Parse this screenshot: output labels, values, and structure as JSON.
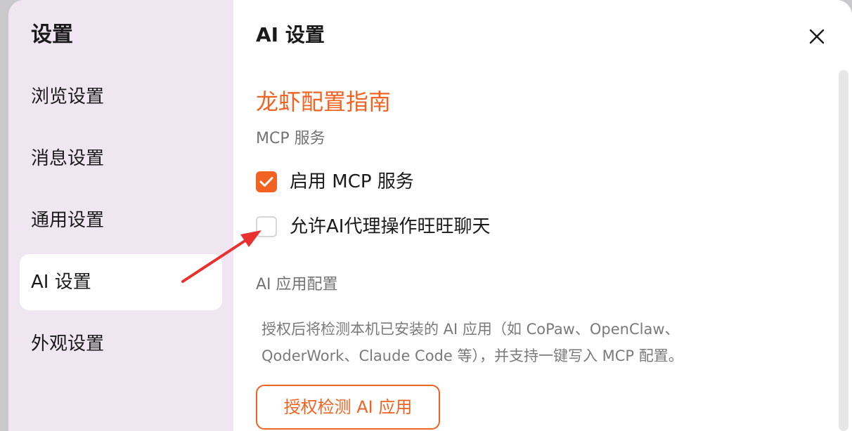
{
  "sidebar": {
    "title": "设置",
    "items": [
      {
        "label": "浏览设置"
      },
      {
        "label": "消息设置"
      },
      {
        "label": "通用设置"
      },
      {
        "label": "AI 设置",
        "active": true
      },
      {
        "label": "外观设置"
      }
    ]
  },
  "main": {
    "title": "AI 设置",
    "guide_link": "龙虾配置指南",
    "mcp_section": {
      "label": "MCP 服务",
      "options": [
        {
          "label": "启用 MCP 服务",
          "checked": true
        },
        {
          "label": "允许AI代理操作旺旺聊天",
          "checked": false
        }
      ]
    },
    "ai_app_section": {
      "label": "AI 应用配置",
      "description_line1": "授权后将检测本机已安装的 AI 应用（如 CoPaw、OpenClaw、",
      "description_line2": "QoderWork、Claude Code 等），并支持一键写入 MCP 配置。",
      "button_label": "授权检测 AI 应用"
    }
  },
  "icons": {
    "close": "close-icon",
    "check": "checkmark-icon"
  },
  "colors": {
    "accent": "#f26322",
    "sidebar_bg": "#f0e6f2",
    "annotation_arrow": "#e8322f"
  }
}
